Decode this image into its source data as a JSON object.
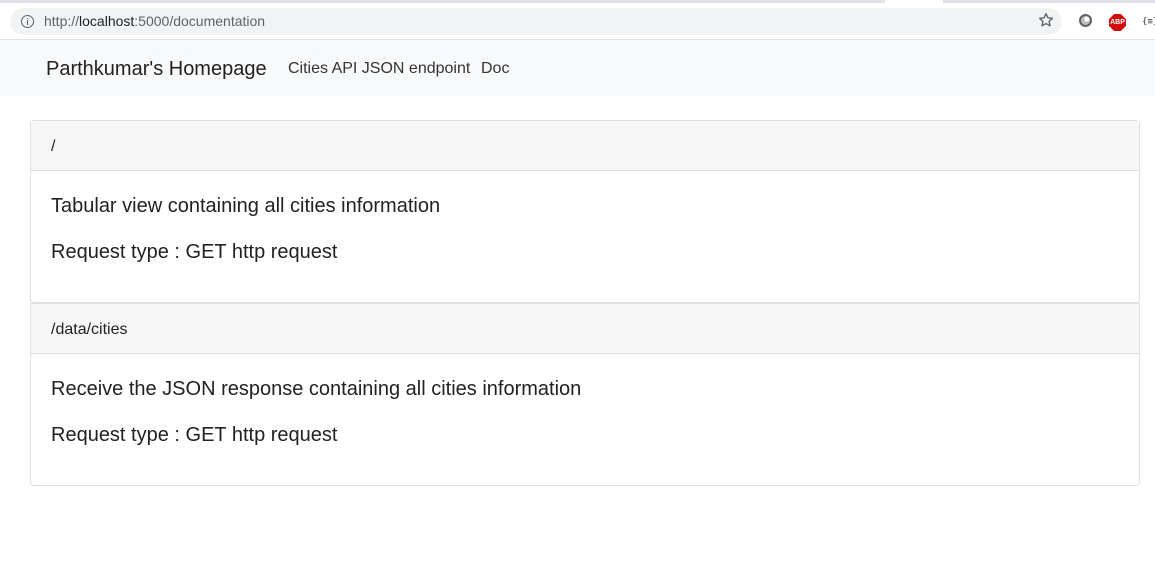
{
  "browser": {
    "url_host": "localhost",
    "url_prefix": "http://",
    "url_suffix": ":5000/documentation",
    "extensions": {
      "abp_label": "ABP",
      "json_label": "{≡}"
    }
  },
  "navbar": {
    "brand": "Parthkumar's Homepage",
    "links": [
      {
        "label": "Cities API JSON endpoint"
      },
      {
        "label": "Doc"
      }
    ]
  },
  "endpoints": [
    {
      "path": "/",
      "description": "Tabular view containing all cities information",
      "request_type": "Request type : GET http request"
    },
    {
      "path": "/data/cities",
      "description": "Receive the JSON response containing all cities information",
      "request_type": "Request type : GET http request"
    }
  ]
}
